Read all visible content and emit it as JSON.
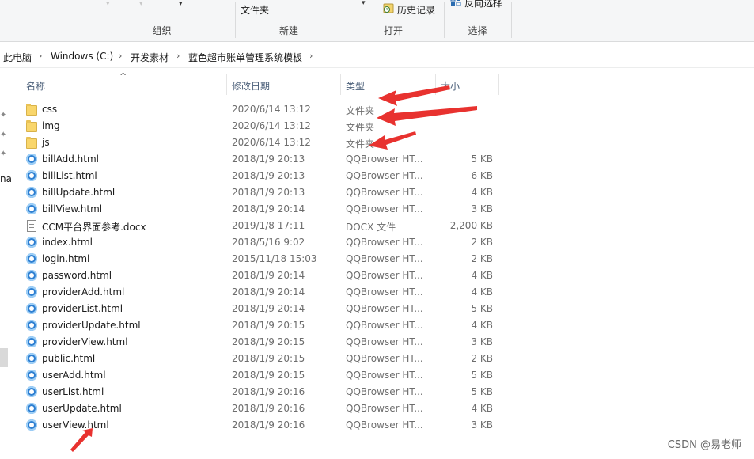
{
  "ribbon": {
    "organize_label": "组织",
    "new_label": "新建",
    "new_folder_label": "文件夹",
    "open_label": "打开",
    "history_label": "历史记录",
    "select_label": "选择",
    "invert_select_label": "反向选择"
  },
  "breadcrumb": [
    "此电脑",
    "Windows (C:)",
    "开发素材",
    "蓝色超市账单管理系统模板"
  ],
  "nav": {
    "partial_text": "na"
  },
  "columns": {
    "name": "名称",
    "date": "修改日期",
    "type": "类型",
    "size": "大小"
  },
  "rows": [
    {
      "name": "css",
      "date": "2020/6/14 13:12",
      "type": "文件夹",
      "size": "",
      "icon": "folder-icon"
    },
    {
      "name": "img",
      "date": "2020/6/14 13:12",
      "type": "文件夹",
      "size": "",
      "icon": "folder-icon"
    },
    {
      "name": "js",
      "date": "2020/6/14 13:12",
      "type": "文件夹",
      "size": "",
      "icon": "folder-icon"
    },
    {
      "name": "billAdd.html",
      "date": "2018/1/9 20:13",
      "type": "QQBrowser HT...",
      "size": "5 KB",
      "icon": "qqbrowser-html-icon"
    },
    {
      "name": "billList.html",
      "date": "2018/1/9 20:13",
      "type": "QQBrowser HT...",
      "size": "6 KB",
      "icon": "qqbrowser-html-icon"
    },
    {
      "name": "billUpdate.html",
      "date": "2018/1/9 20:13",
      "type": "QQBrowser HT...",
      "size": "4 KB",
      "icon": "qqbrowser-html-icon"
    },
    {
      "name": "billView.html",
      "date": "2018/1/9 20:14",
      "type": "QQBrowser HT...",
      "size": "3 KB",
      "icon": "qqbrowser-html-icon"
    },
    {
      "name": "CCM平台界面参考.docx",
      "date": "2019/1/8 17:11",
      "type": "DOCX 文件",
      "size": "2,200 KB",
      "icon": "document-icon"
    },
    {
      "name": "index.html",
      "date": "2018/5/16 9:02",
      "type": "QQBrowser HT...",
      "size": "2 KB",
      "icon": "qqbrowser-html-icon"
    },
    {
      "name": "login.html",
      "date": "2015/11/18 15:03",
      "type": "QQBrowser HT...",
      "size": "2 KB",
      "icon": "qqbrowser-html-icon"
    },
    {
      "name": "password.html",
      "date": "2018/1/9 20:14",
      "type": "QQBrowser HT...",
      "size": "4 KB",
      "icon": "qqbrowser-html-icon"
    },
    {
      "name": "providerAdd.html",
      "date": "2018/1/9 20:14",
      "type": "QQBrowser HT...",
      "size": "4 KB",
      "icon": "qqbrowser-html-icon"
    },
    {
      "name": "providerList.html",
      "date": "2018/1/9 20:14",
      "type": "QQBrowser HT...",
      "size": "5 KB",
      "icon": "qqbrowser-html-icon"
    },
    {
      "name": "providerUpdate.html",
      "date": "2018/1/9 20:15",
      "type": "QQBrowser HT...",
      "size": "4 KB",
      "icon": "qqbrowser-html-icon"
    },
    {
      "name": "providerView.html",
      "date": "2018/1/9 20:15",
      "type": "QQBrowser HT...",
      "size": "3 KB",
      "icon": "qqbrowser-html-icon"
    },
    {
      "name": "public.html",
      "date": "2018/1/9 20:15",
      "type": "QQBrowser HT...",
      "size": "2 KB",
      "icon": "qqbrowser-html-icon"
    },
    {
      "name": "userAdd.html",
      "date": "2018/1/9 20:15",
      "type": "QQBrowser HT...",
      "size": "5 KB",
      "icon": "qqbrowser-html-icon"
    },
    {
      "name": "userList.html",
      "date": "2018/1/9 20:16",
      "type": "QQBrowser HT...",
      "size": "5 KB",
      "icon": "qqbrowser-html-icon"
    },
    {
      "name": "userUpdate.html",
      "date": "2018/1/9 20:16",
      "type": "QQBrowser HT...",
      "size": "4 KB",
      "icon": "qqbrowser-html-icon"
    },
    {
      "name": "userView.html",
      "date": "2018/1/9 20:16",
      "type": "QQBrowser HT...",
      "size": "3 KB",
      "icon": "qqbrowser-html-icon"
    }
  ],
  "watermark": "CSDN @易老师",
  "colors": {
    "annotation_arrow": "#e8322f",
    "header_text": "#4c607a",
    "folder": "#f9d66b",
    "html_icon": "#2e7fd1"
  }
}
